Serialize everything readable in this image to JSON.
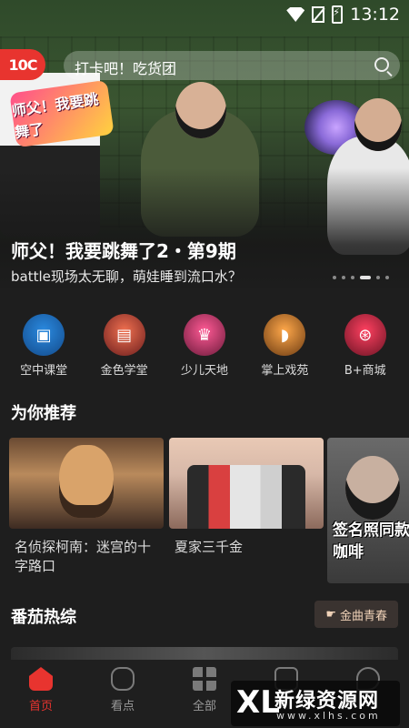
{
  "status_bar": {
    "time": "13:12"
  },
  "top_bar": {
    "logo_text": "10C",
    "search_placeholder": "打卡吧！吃货团"
  },
  "hero": {
    "show_logo_text": "师父！我要跳舞了",
    "title": "师父！我要跳舞了2・第9期",
    "subtitle": "battle现场太无聊，萌娃睡到流口水？",
    "carousel": {
      "count": 6,
      "active_index": 3
    }
  },
  "categories": [
    {
      "label": "空中课堂",
      "icon": "classroom-icon",
      "color": "#2a8ae0"
    },
    {
      "label": "金色学堂",
      "icon": "school-icon",
      "color": "#f07050"
    },
    {
      "label": "少儿天地",
      "icon": "kids-icon",
      "color": "#ff5a95"
    },
    {
      "label": "掌上戏苑",
      "icon": "opera-fan-icon",
      "color": "#ffa84a"
    },
    {
      "label": "B+商城",
      "icon": "shopping-cart-icon",
      "color": "#ff4060"
    }
  ],
  "recommend": {
    "title": "为你推荐",
    "items": [
      {
        "title": "名侦探柯南：迷宫的十字路口"
      },
      {
        "title": "夏家三千金"
      },
      {
        "promo_text": "签名照同款咖啡"
      }
    ]
  },
  "variety": {
    "title": "番茄热综",
    "tag": "金曲青春"
  },
  "tabs": [
    {
      "label": "首页",
      "icon": "home-icon",
      "active": true
    },
    {
      "label": "看点",
      "icon": "sofa-icon",
      "active": false
    },
    {
      "label": "全部",
      "icon": "grid-icon",
      "active": false
    },
    {
      "label": "",
      "icon": "tv-icon",
      "active": false
    },
    {
      "label": "",
      "icon": "chat-icon",
      "active": false
    }
  ],
  "watermark": {
    "logo": "XL",
    "name": "新绿资源网",
    "url": "www.xlhs.com"
  },
  "colors": {
    "accent": "#e8342f",
    "background": "#1e1e1e"
  }
}
